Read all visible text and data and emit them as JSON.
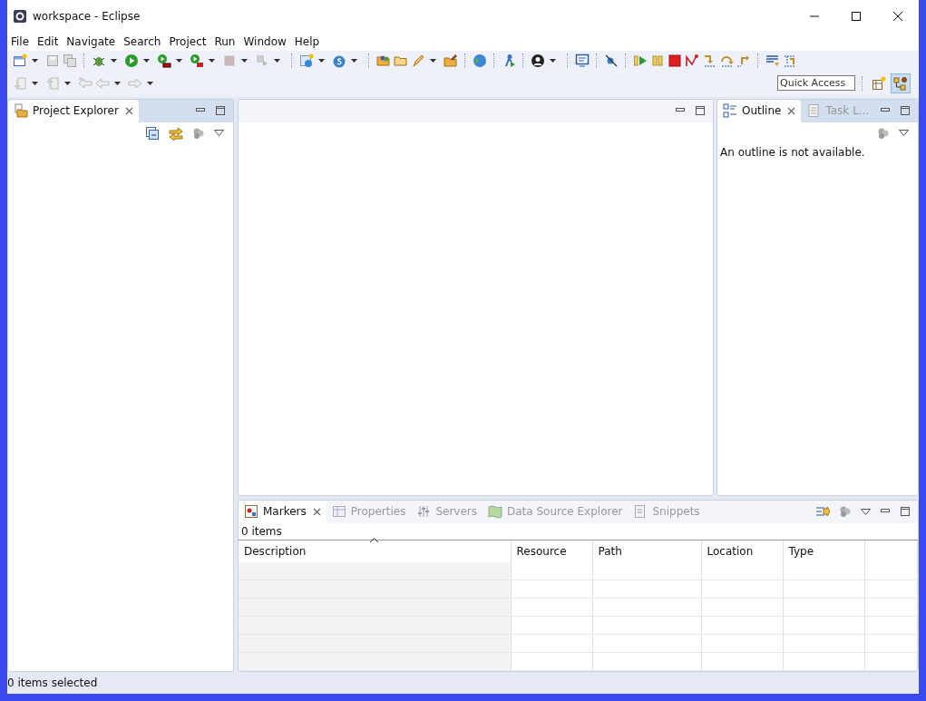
{
  "window": {
    "title": "workspace - Eclipse"
  },
  "menu": [
    "File",
    "Edit",
    "Navigate",
    "Search",
    "Project",
    "Run",
    "Window",
    "Help"
  ],
  "quick_access": {
    "placeholder": "Quick Access"
  },
  "project_explorer": {
    "tabs": [
      {
        "label": "Project Explorer",
        "selected": true
      }
    ]
  },
  "outline": {
    "tabs": [
      {
        "label": "Outline",
        "selected": true
      },
      {
        "label": "Task L...",
        "selected": false
      }
    ],
    "message": "An outline is not available."
  },
  "markers": {
    "tabs": [
      {
        "label": "Markers",
        "selected": true
      },
      {
        "label": "Properties",
        "selected": false
      },
      {
        "label": "Servers",
        "selected": false
      },
      {
        "label": "Data Source Explorer",
        "selected": false
      },
      {
        "label": "Snippets",
        "selected": false
      }
    ],
    "count": "0 items",
    "columns": [
      "Description",
      "Resource",
      "Path",
      "Location",
      "Type"
    ]
  },
  "status_bar": {
    "text": "0 items selected"
  }
}
